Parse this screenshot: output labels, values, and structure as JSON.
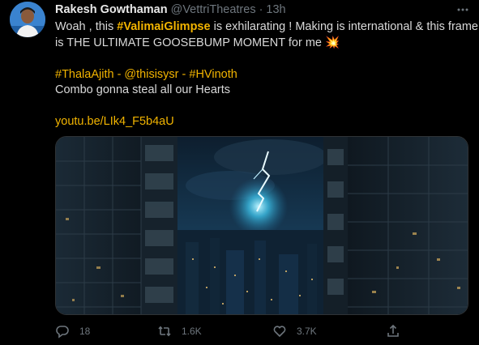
{
  "author": {
    "name": "Rakesh Gowthaman",
    "handle": "@VettriTheatres",
    "separator": "·",
    "time": "13h"
  },
  "tweet": {
    "line1_pre": "Woah , this ",
    "line1_hashtag": "#ValimaiGlimpse",
    "line1_post": " is exhilarating ! Making is international & this frame",
    "line2": "is THE ULTIMATE GOOSEBUMP MOMENT for me",
    "line2_emoji": "💥",
    "tags_line": "#ThalaAjith - @thisisysr - #HVinoth",
    "line4": "Combo gonna steal all our Hearts",
    "link": "youtu.be/LIk4_F5b4aU"
  },
  "media": {
    "description_icon": "lightning-city-image"
  },
  "actions": {
    "reply_count": "18",
    "retweet_count": "1.6K",
    "like_count": "3.7K"
  },
  "colors": {
    "background": "#000000",
    "accent": "#f2b400",
    "muted": "#6e767d"
  }
}
